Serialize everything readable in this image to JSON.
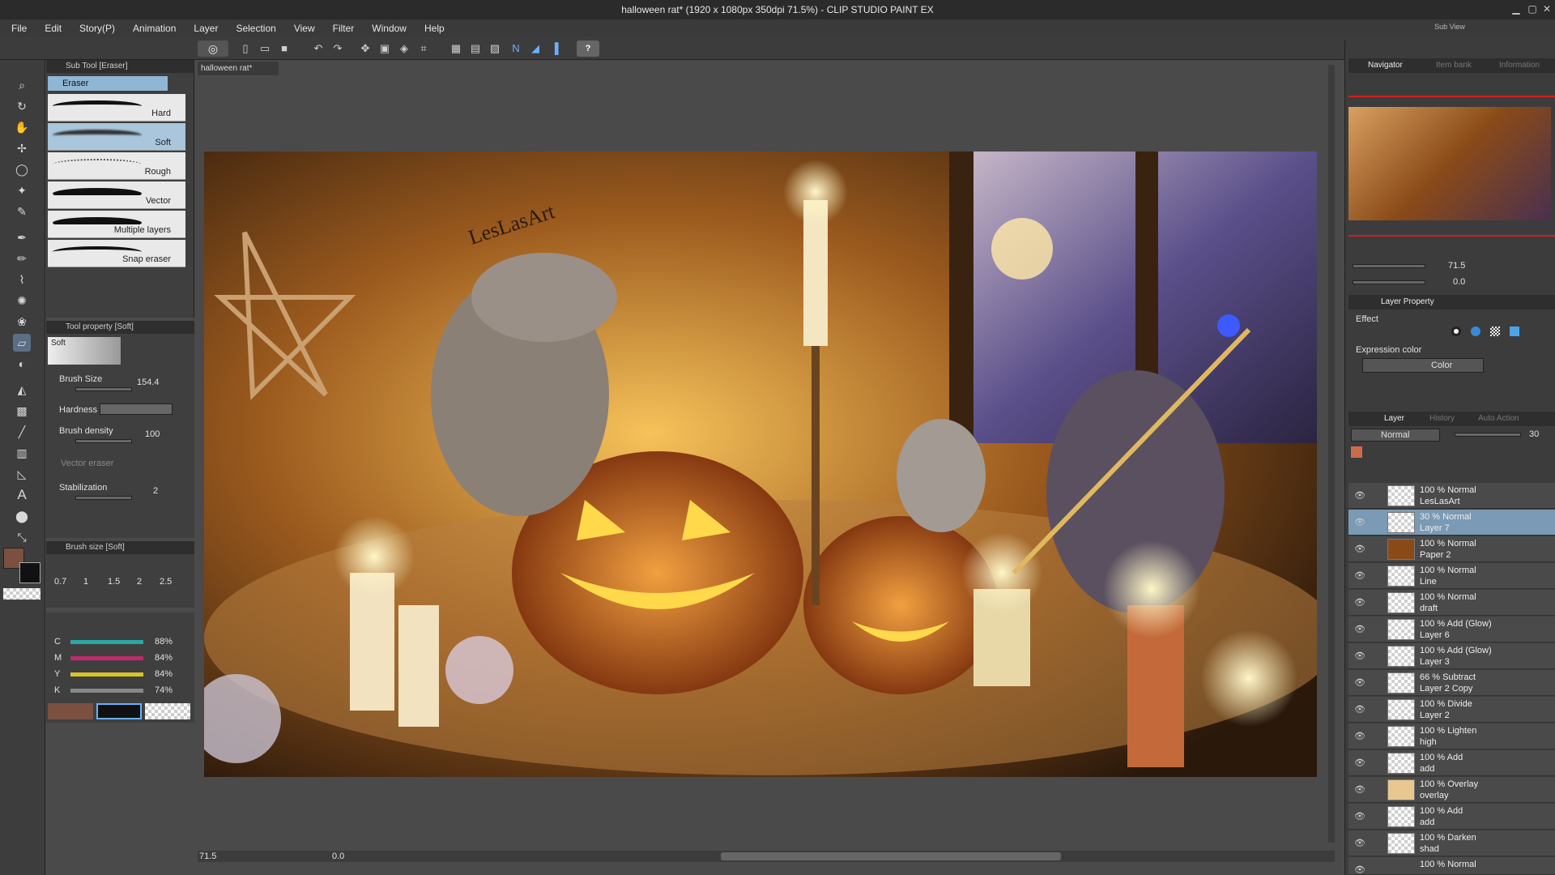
{
  "window": {
    "title": "halloween rat* (1920 x 1080px 350dpi 71.5%) - CLIP STUDIO PAINT EX"
  },
  "menu": [
    "File",
    "Edit",
    "Story(P)",
    "Animation",
    "Layer",
    "Selection",
    "View",
    "Filter",
    "Window",
    "Help"
  ],
  "subview_label": "Sub View",
  "document_tab": "halloween rat*",
  "subtool": {
    "header": "Sub Tool [Eraser]",
    "group": "Eraser",
    "brushes": [
      "Hard",
      "Soft",
      "Rough",
      "Vector",
      "Multiple layers",
      "Snap eraser"
    ],
    "selected": "Soft"
  },
  "toolprop": {
    "header": "Tool property [Soft]",
    "preview_label": "Soft",
    "brush_size_label": "Brush Size",
    "brush_size_value": "154.4",
    "hardness_label": "Hardness",
    "density_label": "Brush density",
    "density_value": "100",
    "vector_label": "Vector eraser",
    "stab_label": "Stabilization",
    "stab_value": "2"
  },
  "brushsize": {
    "header": "Brush size [Soft]",
    "sizes": [
      "0.7",
      "1",
      "1.5",
      "2",
      "2.5"
    ]
  },
  "cmyk": [
    {
      "ch": "C",
      "val": "88%",
      "color": "#2aa7a7"
    },
    {
      "ch": "M",
      "val": "84%",
      "color": "#c02a6a"
    },
    {
      "ch": "Y",
      "val": "84%",
      "color": "#d8c42a"
    },
    {
      "ch": "K",
      "val": "74%",
      "color": "#888888"
    }
  ],
  "colors": {
    "main": "#7b5040",
    "sub": "#111111",
    "accent": "#cc6b4b"
  },
  "status": {
    "zoom": "71.5",
    "angle": "0.0"
  },
  "navigator": {
    "tabs": [
      "Navigator",
      "Item bank",
      "Information"
    ],
    "zoom": "71.5",
    "angle": "0.0"
  },
  "layerprop": {
    "tab": "Layer Property",
    "effect_label": "Effect",
    "expr_label": "Expression color",
    "expr_value": "Color"
  },
  "layerpanel": {
    "tabs": [
      "Layer",
      "History",
      "Auto Action"
    ],
    "blend": "Normal",
    "opacity": "30"
  },
  "layers": [
    {
      "mode": "100 % Normal",
      "name": "LesLasArt"
    },
    {
      "mode": "30 % Normal",
      "name": "Layer 7"
    },
    {
      "mode": "100 % Normal",
      "name": "Paper 2"
    },
    {
      "mode": "100 % Normal",
      "name": "Line"
    },
    {
      "mode": "100 % Normal",
      "name": "draft"
    },
    {
      "mode": "100 % Add (Glow)",
      "name": "Layer 6"
    },
    {
      "mode": "100 % Add (Glow)",
      "name": "Layer 3"
    },
    {
      "mode": "66 % Subtract",
      "name": "Layer 2 Copy"
    },
    {
      "mode": "100 % Divide",
      "name": "Layer 2"
    },
    {
      "mode": "100 % Lighten",
      "name": "high"
    },
    {
      "mode": "100 % Add",
      "name": "add"
    },
    {
      "mode": "100 % Overlay",
      "name": "overlay"
    },
    {
      "mode": "100 % Add",
      "name": "add"
    },
    {
      "mode": "100 % Darken",
      "name": "shad"
    },
    {
      "mode": "100 % Normal",
      "name": ""
    }
  ],
  "selected_layer": 1,
  "artwork": {
    "signature": "LesLasArt"
  }
}
